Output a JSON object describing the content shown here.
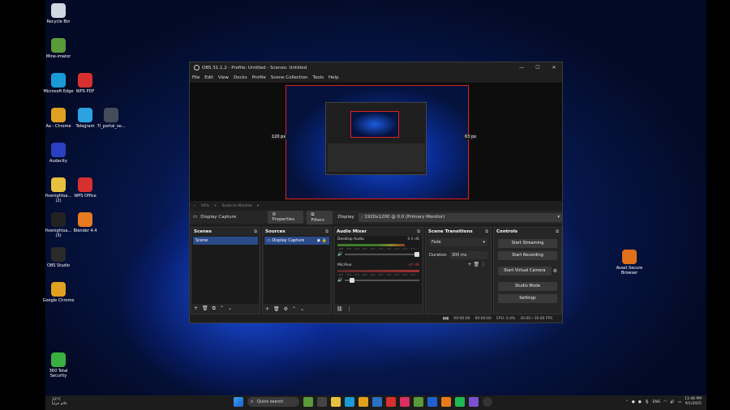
{
  "desktop_icons": [
    {
      "label": "Recycle Bin",
      "icon": "recycle-bin-icon",
      "color": "#cfd8e0"
    },
    {
      "label": "Mine-imator",
      "icon": "mine-imator-icon",
      "color": "#5a9a3a"
    },
    {
      "label": "Microsoft Edge",
      "icon": "edge-icon",
      "color": "#1a9ad6"
    },
    {
      "label": "WPS PDF",
      "icon": "wps-pdf-icon",
      "color": "#d83030"
    },
    {
      "label": "Aa - Chrome",
      "icon": "chrome-icon",
      "color": "#e0a020"
    },
    {
      "label": "Telegram",
      "icon": "telegram-icon",
      "color": "#2aa3e0"
    },
    {
      "label": "7l_portal_se...",
      "icon": "portal-icon",
      "color": "#444c5a"
    },
    {
      "label": "Audacity",
      "icon": "audacity-icon",
      "color": "#2a40c0"
    },
    {
      "label": "fivenightsa... (2)",
      "icon": "folder-icon",
      "color": "#e8c040"
    },
    {
      "label": "WPS Office",
      "icon": "wps-office-icon",
      "color": "#d83030"
    },
    {
      "label": "fivenightsa... (3)",
      "icon": "fnaf-icon",
      "color": "#222"
    },
    {
      "label": "Blender 4.4",
      "icon": "blender-icon",
      "color": "#e87a20"
    },
    {
      "label": "OBS Studio",
      "icon": "obs-icon",
      "color": "#2a2a2a"
    },
    {
      "label": "Google Chrome",
      "icon": "chrome-icon",
      "color": "#e0a020"
    },
    {
      "label": "360 Total Security",
      "icon": "360-security-icon",
      "color": "#3ab040"
    },
    {
      "label": "Avast Secure Browser",
      "icon": "avast-browser-icon",
      "color": "#e0701a"
    }
  ],
  "obs": {
    "title": "OBS 31.1.2 - Profile: Untitled - Scenes: Untitled",
    "menu": [
      "File",
      "Edit",
      "View",
      "Docks",
      "Profile",
      "Scene Collection",
      "Tools",
      "Help"
    ],
    "preview": {
      "left_label": "120 px",
      "right_label": "63 px"
    },
    "zoom_bar": {
      "zoom": "50%",
      "scale": "Scale to Window"
    },
    "source_bar": {
      "name": "Display Capture",
      "properties": "Properties",
      "filters": "Filters",
      "display_label": "Display",
      "display_value": ": 1920x1200 @ 0,0 (Primary Monitor)"
    },
    "docks": {
      "scenes": {
        "title": "Scenes",
        "items": [
          "Scene"
        ]
      },
      "sources": {
        "title": "Sources",
        "items": [
          "Display Capture"
        ]
      },
      "mixer": {
        "title": "Audio Mixer",
        "tracks": [
          {
            "name": "Desktop Audio",
            "db": "0.0 dB",
            "level": 0.82,
            "volume": 1.0
          },
          {
            "name": "Mic/Aux",
            "db": "-inf dB",
            "level": 0.0,
            "volume": 0.1
          }
        ],
        "ticks": "-60 -55 -50 -45 -40 -35 -30 -25 -20 -15 -10 -5 0"
      },
      "transitions": {
        "title": "Scene Transitions",
        "type": "Fade",
        "duration_label": "Duration",
        "duration": "300 ms"
      },
      "controls": {
        "title": "Controls",
        "buttons": [
          "Start Streaming",
          "Start Recording",
          "Start Virtual Camera",
          "Studio Mode",
          "Settings"
        ]
      }
    },
    "status": {
      "rec_time": "00:00:00",
      "stream_time": "00:00:00",
      "cpu": "CPU: 0.4%",
      "fps": "30.00 / 30.00 FPS"
    }
  },
  "taskbar": {
    "weather_temp": "33°C",
    "weather_desc": "غائم جزئياً",
    "search": "Quick search",
    "lang": "ENG",
    "time": "11:46 PM",
    "date": "9/1/2025"
  }
}
